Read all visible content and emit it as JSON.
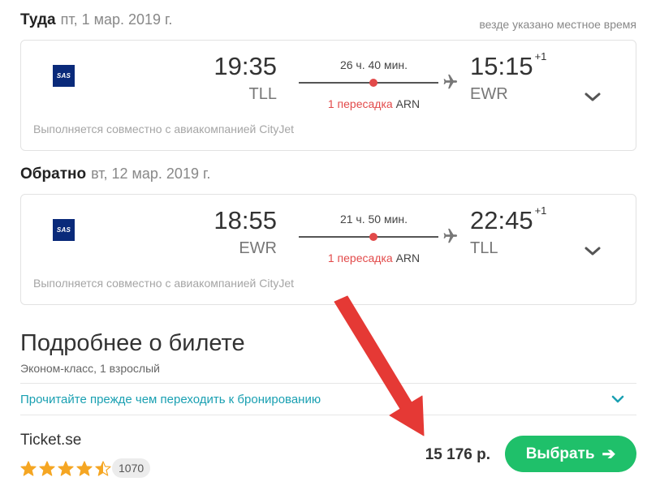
{
  "outbound": {
    "direction": "Туда",
    "date": "пт, 1 мар. 2019 г.",
    "airline_logo_text": "SAS",
    "dep_time": "19:35",
    "dep_code": "TLL",
    "arr_time": "15:15",
    "arr_plus": "+1",
    "arr_code": "EWR",
    "duration": "26 ч. 40 мин.",
    "stops_label": "1 пересадка",
    "stop_airport": "ARN",
    "operated_by": "Выполняется совместно с авиакомпанией CityJet"
  },
  "return": {
    "direction": "Обратно",
    "date": "вт, 12 мар. 2019 г.",
    "airline_logo_text": "SAS",
    "dep_time": "18:55",
    "dep_code": "EWR",
    "arr_time": "22:45",
    "arr_plus": "+1",
    "arr_code": "TLL",
    "duration": "21 ч. 50 мин.",
    "stops_label": "1 пересадка",
    "stop_airport": "ARN",
    "operated_by": "Выполняется совместно с авиакомпанией CityJet"
  },
  "local_time_note": "везде указано местное время",
  "details": {
    "title": "Подробнее о билете",
    "subtitle": "Эконом-класс, 1 взрослый",
    "read_before_link": "Прочитайте прежде чем переходить к бронированию"
  },
  "offer": {
    "agency": "Ticket.se",
    "rating": 4.5,
    "rating_max": 5,
    "reviews_count": "1070",
    "price": "15 176 р.",
    "select_label": "Выбрать",
    "select_arrow": "➔"
  },
  "colors": {
    "accent_green": "#1fc06a",
    "link_teal": "#1aa0b2",
    "stop_red": "#e24a4a",
    "star_gold": "#f5a623",
    "annotation_arrow": "#e53935",
    "sas_blue": "#0a2a7a"
  },
  "icons": {
    "airline": "sas-logo-icon",
    "plane": "plane-icon",
    "expand": "chevron-down-icon",
    "star": "star-icon",
    "arrow": "arrow-right-icon",
    "annotation": "red-annotation-arrow"
  }
}
